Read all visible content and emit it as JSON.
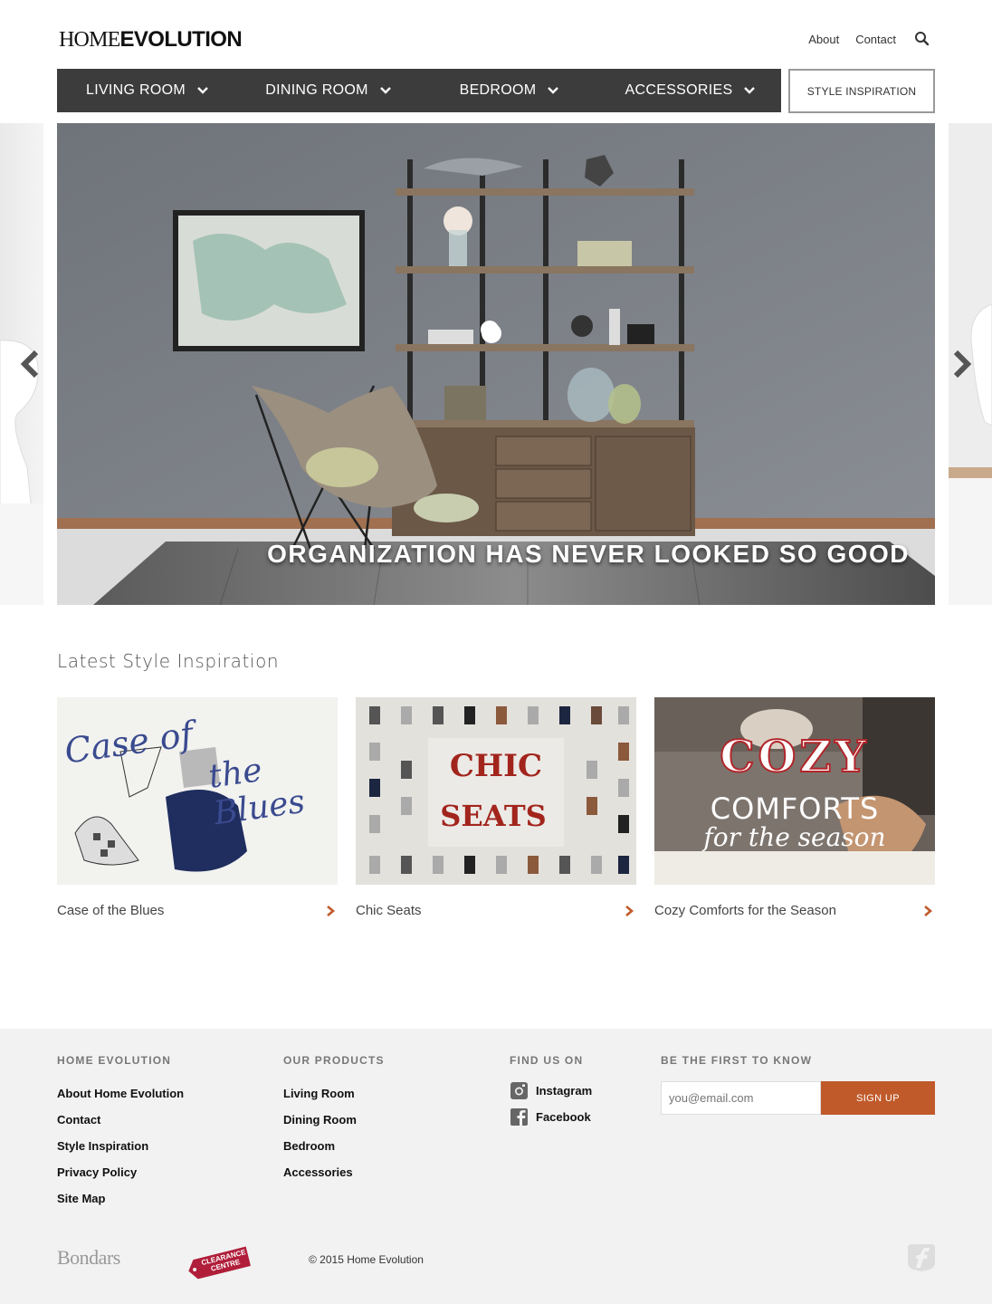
{
  "header": {
    "logo_part1": "HOME",
    "logo_part2": "EVOLUTION",
    "links": [
      "About",
      "Contact"
    ]
  },
  "nav": {
    "items": [
      "LIVING ROOM",
      "DINING ROOM",
      "BEDROOM",
      "ACCESSORIES"
    ],
    "style_button": "STYLE INSPIRATION"
  },
  "hero": {
    "caption": "ORGANIZATION HAS NEVER LOOKED SO GOOD"
  },
  "inspiration": {
    "title": "Latest Style Inspiration",
    "cards": [
      {
        "label": "Case of the Blues",
        "art_line1": "Case of",
        "art_line2": "the Blues"
      },
      {
        "label": "Chic Seats",
        "art_line1": "CHIC",
        "art_line2": "SEATS"
      },
      {
        "label": "Cozy Comforts for the Season",
        "art_line1": "COZY",
        "art_line2": "COMFORTS",
        "art_line3": "for the season"
      }
    ]
  },
  "footer": {
    "col1": {
      "heading": "HOME EVOLUTION",
      "links": [
        "About Home Evolution",
        "Contact",
        "Style Inspiration",
        "Privacy Policy",
        "Site Map"
      ]
    },
    "col2": {
      "heading": "OUR PRODUCTS",
      "links": [
        "Living Room",
        "Dining Room",
        "Bedroom",
        "Accessories"
      ]
    },
    "col3": {
      "heading": "FIND US ON",
      "links": [
        "Instagram",
        "Facebook"
      ]
    },
    "col4": {
      "heading": "BE THE FIRST TO KNOW",
      "email_placeholder": "you@email.com",
      "signup": "SIGN UP"
    },
    "bondars": "Bondars",
    "clearance": "CLEARANCE CENTRE",
    "copyright": "© 2015 Home Evolution"
  },
  "colors": {
    "nav_bg": "#3c3c3c",
    "accent": "#c05a2b",
    "footer_bg": "#f2f2f2"
  },
  "icons": [
    "search-icon",
    "chevron-down-icon",
    "chevron-left-icon",
    "chevron-right-icon",
    "instagram-icon",
    "facebook-icon"
  ]
}
